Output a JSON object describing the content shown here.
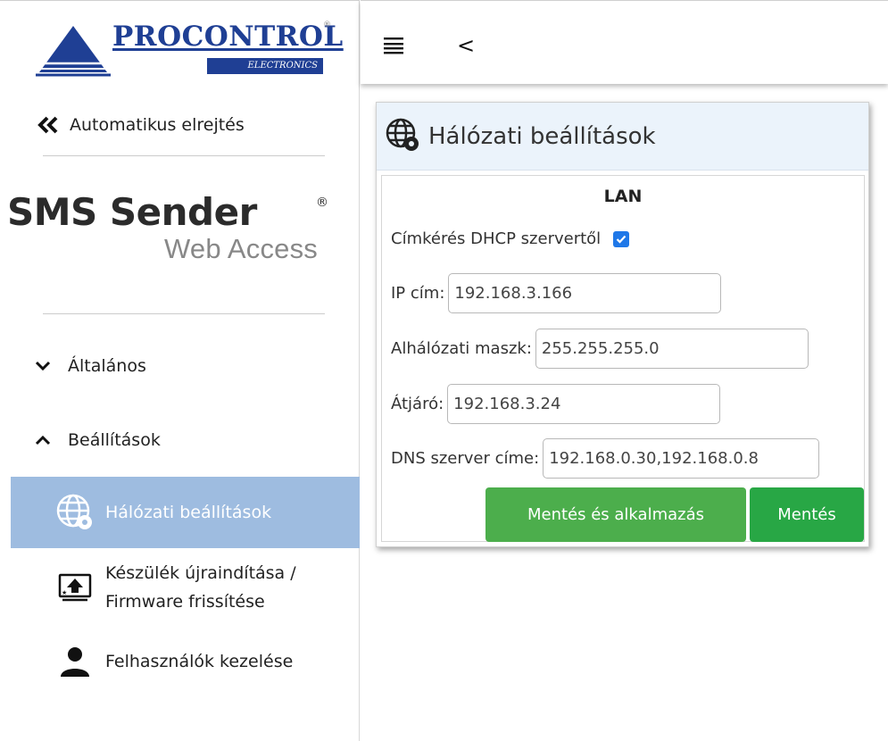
{
  "brand": {
    "name": "PROCONTROL",
    "sub": "ELECTRONICS",
    "reg": "®"
  },
  "sidebar": {
    "autohide_label": "Automatikus elrejtés",
    "product_title": "SMS Sender",
    "product_reg": "®",
    "product_sub": "Web Access",
    "groups": [
      {
        "label": "Általános",
        "expanded": false
      },
      {
        "label": "Beállítások",
        "expanded": true
      }
    ],
    "items": [
      {
        "label": "Hálózati beállítások",
        "icon": "globe-gear-icon",
        "active": true
      },
      {
        "label_line1": "Készülék újraindítása /",
        "label_line2": "Firmware frissítése",
        "icon": "monitor-upload-icon",
        "active": false
      },
      {
        "label": "Felhasználók kezelése",
        "icon": "user-icon",
        "active": false
      }
    ]
  },
  "topbar": {
    "menu_icon": "hamburger-icon",
    "back_icon": "chevron-left-icon",
    "back_glyph": "<"
  },
  "card": {
    "title": "Hálózati beállítások",
    "section": "LAN",
    "dhcp_label": "Címkérés DHCP szervertől",
    "dhcp_checked": true,
    "ip_label": "IP cím:",
    "ip_value": "192.168.3.166",
    "mask_label": "Alhálózati maszk:",
    "mask_value": "255.255.255.0",
    "gateway_label": "Átjáró:",
    "gateway_value": "192.168.3.24",
    "dns_label": "DNS szerver címe:",
    "dns_value": "192.168.0.30,192.168.0.8",
    "apply_button": "Mentés és alkalmazás",
    "save_button": "Mentés"
  },
  "colors": {
    "brand_blue": "#1f3f94",
    "active_item_bg": "#9ebce0",
    "card_header_bg": "#ebf3fb",
    "apply_green": "#4cae4c",
    "save_green": "#28a745",
    "checkbox_blue": "#1f78e8"
  }
}
